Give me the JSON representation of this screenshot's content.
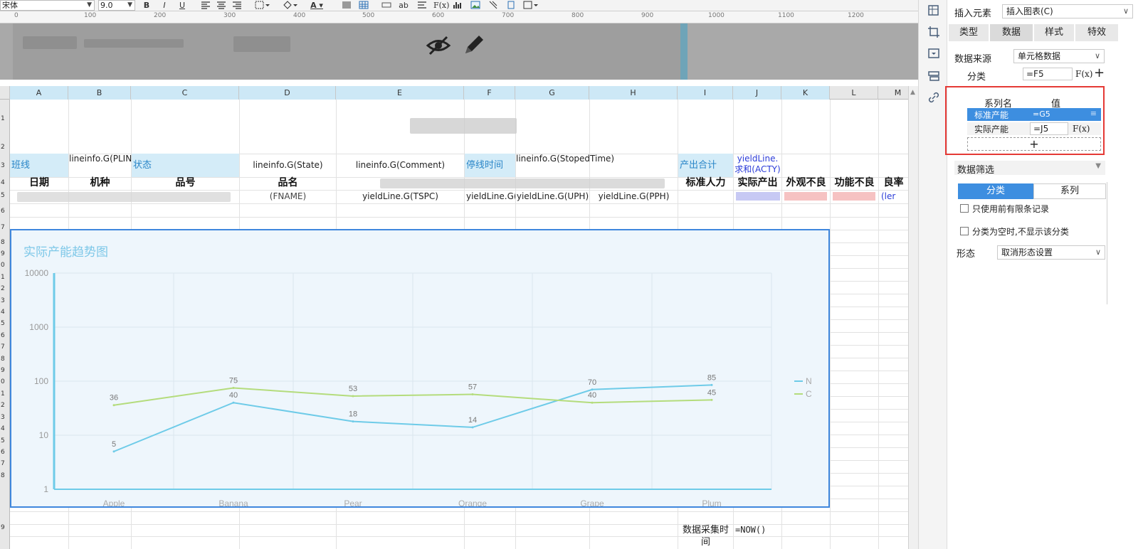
{
  "toolbar": {
    "font_name": "宋体",
    "font_size": "9.0",
    "bold": "B",
    "italic": "I",
    "underline": "U",
    "ab_label": "ab",
    "fx_label": "F(x)",
    "font_color_label": "A"
  },
  "ruler": {
    "ticks": [
      "0",
      "100",
      "200",
      "300",
      "400",
      "500",
      "600",
      "700",
      "800",
      "900",
      "1000",
      "1100",
      "1200"
    ]
  },
  "columns": [
    "A",
    "B",
    "C",
    "D",
    "E",
    "F",
    "G",
    "H",
    "I",
    "J",
    "K",
    "L",
    "M"
  ],
  "rows": [
    "1",
    "2",
    "3",
    "4",
    "5",
    "6",
    "7",
    "8",
    "9",
    "0",
    "1",
    "2",
    "3",
    "4",
    "5",
    "6",
    "7",
    "8",
    "9",
    "0",
    "1",
    "2",
    "3",
    "4",
    "5",
    "6",
    "7",
    "8",
    "9"
  ],
  "sheet": {
    "row3": {
      "a": "班线",
      "b": "lineinfo.G(PLINE)",
      "c": "状态",
      "d": "lineinfo.G(State)",
      "e": "lineinfo.G(Comment)",
      "f": "停线时间",
      "g": "lineinfo.G(StopedTime)",
      "i": "产出合计",
      "j": "yieldLine.求和(ACTY)"
    },
    "row4": {
      "a": "日期",
      "b": "机种",
      "c": "品号",
      "d": "品名",
      "i": "标准人力",
      "j": "实际产出",
      "k": "外观不良",
      "l": "功能不良",
      "m": "良率"
    },
    "row5": {
      "d": "(FNAME)",
      "e": "yieldLine.G(TSPC)",
      "f": "yieldLine.G(",
      "g": "yieldLine.G(UPH)",
      "h": "yieldLine.G(PPH)",
      "m": "(ler"
    },
    "footer": {
      "label": "数据采集时间",
      "formula": "=NOW()"
    }
  },
  "chart_data": {
    "type": "line",
    "title": "实际产能趋势图",
    "categories": [
      "Apple",
      "Banana",
      "Pear",
      "Orange",
      "Grape",
      "Plum"
    ],
    "series": [
      {
        "name": "N",
        "values": [
          5,
          40,
          18,
          14,
          70,
          85
        ],
        "color": "#6ecbe8"
      },
      {
        "name": "C",
        "values": [
          36,
          75,
          53,
          57,
          40,
          45
        ],
        "color": "#b4dc7c"
      }
    ],
    "y_scale": "log",
    "ylim": [
      1,
      10000
    ],
    "y_ticks": [
      "1",
      "10",
      "100",
      "1000",
      "10000"
    ],
    "legend": "right",
    "grid": true
  },
  "panel": {
    "insert_label": "插入元素",
    "insert_value": "插入图表(C)",
    "tabs": [
      "类型",
      "数据",
      "样式",
      "特效"
    ],
    "source_label": "数据来源",
    "source_value": "单元格数据",
    "category_label": "分类",
    "category_value": "=F5",
    "series_header_name": "系列名",
    "series_header_value": "值",
    "series": [
      {
        "name": "标准产能",
        "value": "=G5"
      },
      {
        "name": "实际产能",
        "value": "=J5"
      }
    ],
    "add_label": "+",
    "fx_label": "F(x)",
    "filter_label": "数据筛选",
    "filter_tabs": [
      "分类",
      "系列"
    ],
    "check1": "只使用前有限条记录",
    "check2": "分类为空时,不显示该分类",
    "shape_label": "形态",
    "shape_value": "取消形态设置"
  }
}
